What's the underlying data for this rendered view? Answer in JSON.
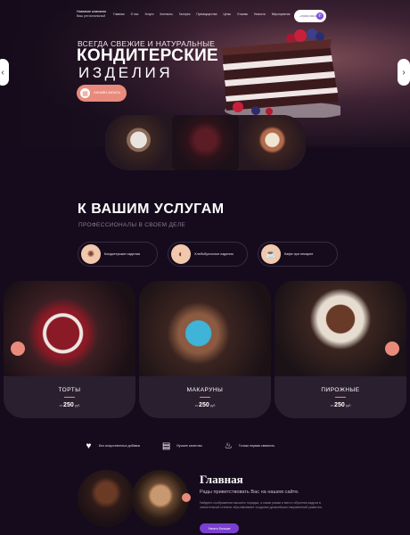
{
  "header": {
    "logo_title": "Название компании",
    "logo_sub": "Ваш региональный",
    "nav": [
      "Главная",
      "О нас",
      "Услуги",
      "Контакты",
      "Галерея",
      "Преимущества",
      "Цены",
      "Отзывы",
      "Новости",
      "Мероприятия",
      "Ещё"
    ],
    "phone": "+7(000) 000-00-00",
    "call_icon": "phone-icon"
  },
  "hero": {
    "kicker": "ВСЕГДА СВЕЖИЕ И НАТУРАЛЬНЫЕ",
    "title_line1": "КОНДИТЕРСКИЕ",
    "title_line2": "ИЗДЕЛИЯ",
    "cta_label": "Онлайн-запись",
    "prev_icon": "chevron-left-icon",
    "next_icon": "chevron-right-icon"
  },
  "services": {
    "heading": "К ВАШИМ УСЛУГАМ",
    "subheading": "ПРОФЕССИОНАЛЫ В СВОЕМ ДЕЛЕ",
    "items": [
      {
        "label": "Кондитерские изделия",
        "icon": "cookie-icon"
      },
      {
        "label": "Хлебобулочные изделия",
        "icon": "croissant-icon"
      },
      {
        "label": "Кафе при пекарне",
        "icon": "cup-icon"
      }
    ]
  },
  "products": [
    {
      "name": "ТОРТЫ",
      "price_prefix": "от",
      "price": "250",
      "price_suffix": "руб"
    },
    {
      "name": "МАКАРУНЫ",
      "price_prefix": "от",
      "price": "250",
      "price_suffix": "руб"
    },
    {
      "name": "ПИРОЖНЫЕ",
      "price_prefix": "от",
      "price": "250",
      "price_suffix": "руб"
    }
  ],
  "features": [
    {
      "label": "Без искусственных добавок",
      "icon": "strawberry-icon"
    },
    {
      "label": "Лучшее качество",
      "icon": "cake-icon"
    },
    {
      "label": "Только первая свежесть",
      "icon": "cupcake-icon"
    }
  ],
  "about": {
    "heading": "Главная",
    "lead": "Рады приветствовать Вас на нашем сайте.",
    "text": "Найдено соображения высшего порядка, а также рамки и место обучения кадров в значительной степени обуславливает создание дальнейших направлений развития.",
    "more_label": "Узнать больше"
  },
  "colors": {
    "accent": "#e98b7c",
    "background": "#150b1c",
    "button_purple": "#7a3fd0"
  }
}
